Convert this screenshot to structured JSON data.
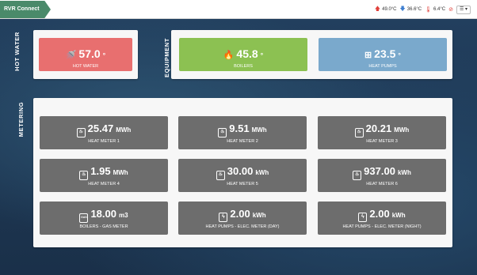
{
  "app": {
    "brand": "RVR Connect"
  },
  "status": {
    "temp_up": "49.0°C",
    "temp_down": "36.6°C",
    "temp_outdoor": "6.4°C"
  },
  "sections": {
    "hot_water": "HOT WATER",
    "equipment": "EQUIPMENT",
    "metering": "METERING"
  },
  "tiles": {
    "hot_water": {
      "value": "57.0",
      "unit": "°",
      "label": "HOT WATER",
      "color": "#e86f6f"
    },
    "boilers": {
      "value": "45.8",
      "unit": "°",
      "label": "BOILERS",
      "color": "#8cc152"
    },
    "heat_pumps": {
      "value": "23.5",
      "unit": "°",
      "label": "HEAT PUMPS",
      "color": "#7aa9cc"
    }
  },
  "meters": [
    {
      "value": "25.47",
      "unit": "MWh",
      "label": "HEAT METER 1",
      "icon": "heat-meter-icon"
    },
    {
      "value": "9.51",
      "unit": "MWh",
      "label": "HEAT METER 2",
      "icon": "heat-meter-icon"
    },
    {
      "value": "20.21",
      "unit": "MWh",
      "label": "HEAT METER 3",
      "icon": "heat-meter-icon"
    },
    {
      "value": "1.95",
      "unit": "MWh",
      "label": "HEAT METER 4",
      "icon": "heat-meter-icon"
    },
    {
      "value": "30.00",
      "unit": "kWh",
      "label": "HEAT METER 5",
      "icon": "heat-meter-icon"
    },
    {
      "value": "937.00",
      "unit": "kWh",
      "label": "HEAT METER 6",
      "icon": "heat-meter-icon"
    },
    {
      "value": "18.00",
      "unit": "m3",
      "label": "BOILERS - GAS METER",
      "icon": "gas-meter-icon",
      "icon_text": "GAS"
    },
    {
      "value": "2.00",
      "unit": "kWh",
      "label": "HEAT PUMPS - ELEC. METER (DAY)",
      "icon": "electric-meter-icon"
    },
    {
      "value": "2.00",
      "unit": "kWh",
      "label": "HEAT PUMPS - ELEC. METER (NIGHT)",
      "icon": "electric-meter-icon"
    }
  ]
}
